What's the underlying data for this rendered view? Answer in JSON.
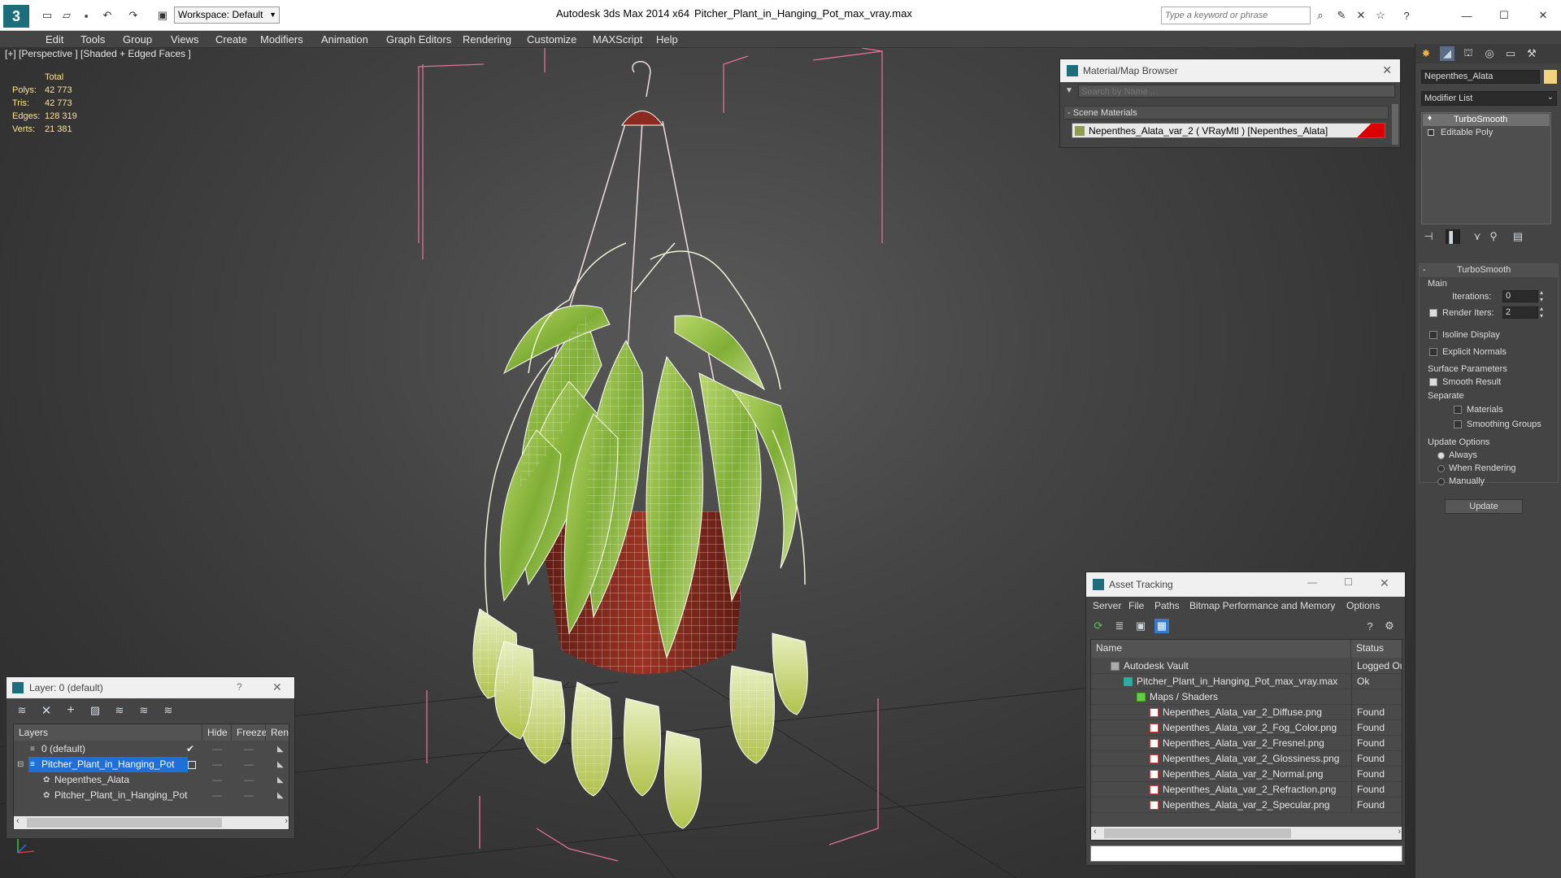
{
  "titlebar": {
    "app_title": "Autodesk 3ds Max  2014 x64",
    "file_title": "Pitcher_Plant_in_Hanging_Pot_max_vray.max",
    "workspace": "Workspace: Default",
    "search_placeholder": "Type a keyword or phrase"
  },
  "menu": [
    "Edit",
    "Tools",
    "Group",
    "Views",
    "Create",
    "Modifiers",
    "Animation",
    "Graph Editors",
    "Rendering",
    "Customize",
    "MAXScript",
    "Help"
  ],
  "viewport": {
    "label": "[+] [Perspective ] [Shaded + Edged Faces ]",
    "stats": {
      "total_label": "Total",
      "rows": [
        {
          "label": "Polys:",
          "value": "42 773"
        },
        {
          "label": "Tris:",
          "value": "42 773"
        },
        {
          "label": "Edges:",
          "value": "128 319"
        },
        {
          "label": "Verts:",
          "value": "21 381"
        }
      ]
    }
  },
  "material_browser": {
    "title": "Material/Map Browser",
    "search_placeholder": "Search by Name ...",
    "section": "- Scene Materials",
    "item": "Nepenthes_Alata_var_2  ( VRayMtl ) [Nepenthes_Alata]"
  },
  "command_panel": {
    "object_name": "Nepenthes_Alata",
    "modifier_list": "Modifier List",
    "stack": [
      "TurboSmooth",
      "Editable Poly"
    ],
    "rollout_title": "TurboSmooth",
    "main_group": "Main",
    "iterations_label": "Iterations:",
    "iterations_value": "0",
    "render_iters_label": "Render Iters:",
    "render_iters_value": "2",
    "isoline": "Isoline Display",
    "explicit_normals": "Explicit Normals",
    "surface_params": "Surface Parameters",
    "smooth_result": "Smooth Result",
    "separate": "Separate",
    "materials": "Materials",
    "smoothing_groups": "Smoothing Groups",
    "update_options": "Update Options",
    "always": "Always",
    "when_rendering": "When Rendering",
    "manually": "Manually",
    "update_button": "Update"
  },
  "layer_panel": {
    "title": "Layer: 0 (default)",
    "help": "?",
    "columns": [
      "Layers",
      "Hide",
      "Freeze",
      "Rende"
    ],
    "rows": [
      {
        "name": "0 (default)"
      },
      {
        "name": "Pitcher_Plant_in_Hanging_Pot"
      },
      {
        "name": "Nepenthes_Alata"
      },
      {
        "name": "Pitcher_Plant_in_Hanging_Pot"
      }
    ]
  },
  "asset_tracking": {
    "title": "Asset Tracking",
    "menu": [
      "Server",
      "File",
      "Paths",
      "Bitmap Performance and Memory",
      "Options"
    ],
    "columns": [
      "Name",
      "Status"
    ],
    "rows": [
      {
        "name": "Autodesk Vault",
        "status": "Logged Ou"
      },
      {
        "name": "Pitcher_Plant_in_Hanging_Pot_max_vray.max",
        "status": "Ok"
      },
      {
        "name": "Maps / Shaders",
        "status": ""
      },
      {
        "name": "Nepenthes_Alata_var_2_Diffuse.png",
        "status": "Found"
      },
      {
        "name": "Nepenthes_Alata_var_2_Fog_Color.png",
        "status": "Found"
      },
      {
        "name": "Nepenthes_Alata_var_2_Fresnel.png",
        "status": "Found"
      },
      {
        "name": "Nepenthes_Alata_var_2_Glossiness.png",
        "status": "Found"
      },
      {
        "name": "Nepenthes_Alata_var_2_Normal.png",
        "status": "Found"
      },
      {
        "name": "Nepenthes_Alata_var_2_Refraction.png",
        "status": "Found"
      },
      {
        "name": "Nepenthes_Alata_var_2_Specular.png",
        "status": "Found"
      }
    ]
  },
  "colors": {
    "selection": "#1f6fd8",
    "bbox": "#e0709a",
    "leaf": "#8fbf3f",
    "pot": "#8b2a1e",
    "stat": "#ffe38a"
  }
}
